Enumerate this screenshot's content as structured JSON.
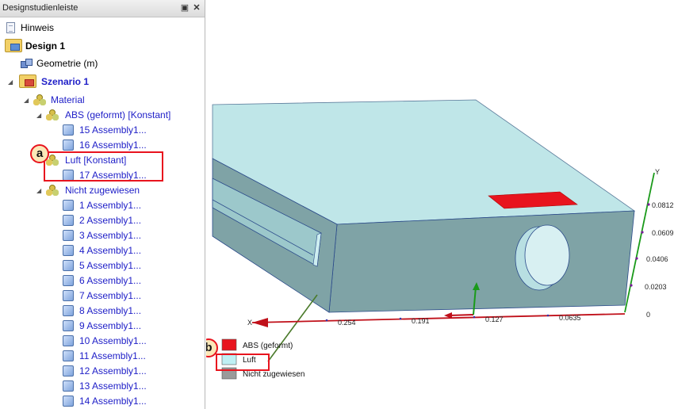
{
  "panel": {
    "title": "Designstudienleiste",
    "pin_icon": "pin-icon",
    "close_icon": "close-icon"
  },
  "tree": {
    "hint": "Hinweis",
    "design": "Design 1",
    "geometry": "Geometrie (m)",
    "scenario": "Szenario 1",
    "material": "Material",
    "abs": "ABS (geformt) [Konstant]",
    "abs_items": [
      "15 Assembly1...",
      "16 Assembly1..."
    ],
    "luft": "Luft [Konstant]",
    "luft_items": [
      "17 Assembly1..."
    ],
    "unassigned": "Nicht zugewiesen",
    "unassigned_items": [
      "1 Assembly1...",
      "2 Assembly1...",
      "3 Assembly1...",
      "4 Assembly1...",
      "5 Assembly1...",
      "6 Assembly1...",
      "7 Assembly1...",
      "8 Assembly1...",
      "9 Assembly1...",
      "10 Assembly1...",
      "11 Assembly1...",
      "12 Assembly1...",
      "13 Assembly1...",
      "14 Assembly1..."
    ]
  },
  "callouts": {
    "a": "a",
    "b": "b"
  },
  "viewport": {
    "x_axis_label": "X",
    "y_axis_label": "Y",
    "x_ticks": [
      "0.254",
      "0.191",
      "0.127",
      "0.0635"
    ],
    "y_ticks": [
      "0.0812",
      "0.0609",
      "0.0406",
      "0.0203",
      "0"
    ],
    "legend": [
      {
        "label": "ABS (geformt)",
        "color": "#e8141e"
      },
      {
        "label": "Luft",
        "color": "#bff0f4"
      },
      {
        "label": "Nicht zugewiesen",
        "color": "#9a9a9a"
      }
    ],
    "colors": {
      "body_top": "#bfe6e8",
      "body_side": "#7fa3a6",
      "axis_red": "#c0101a",
      "axis_green": "#1a9a1a",
      "accent_red": "#e8141e"
    }
  }
}
